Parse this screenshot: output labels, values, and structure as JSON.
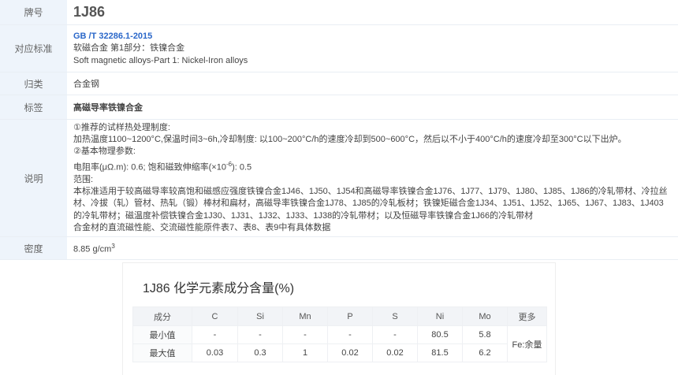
{
  "info": {
    "grade": {
      "label": "牌号",
      "value": "1J86"
    },
    "standard": {
      "label": "对应标准",
      "code": "GB /T 32286.1-2015",
      "title_cn": "软磁合金 第1部分：铁镍合金",
      "title_en": "Soft magnetic alloys-Part 1: Nickel-Iron alloys"
    },
    "classification": {
      "label": "归类",
      "value": "合金钢"
    },
    "tags": {
      "label": "标签",
      "value": "高磁导率铁镍合金"
    },
    "description": {
      "label": "说明",
      "lines": [
        "①推荐的试样热处理制度:",
        "加热温度1100~1200°C,保温时间3~6h,冷却制度: 以100~200°C/h的速度冷却到500~600°C，然后以不小于400°C/h的速度冷却至300°C以下出炉。",
        "②基本物理参数:"
      ],
      "physical_prefix": "电阻率(μΩ.m): 0.6;  饱和磁致伸缩率(×10",
      "physical_exp": "-6",
      "physical_suffix": "): 0.5",
      "scope_label": "范围:",
      "scope_text": "本标准适用于较高磁导率较高饱和磁感应强度铁镍合金1J46、1J50、1J54和高磁导率铁镍合金1J76、1J77、1J79、1J80、1J85、1J86的冷轧带材、冷拉丝材、冷拔（轧）管材、热轧（锻）棒材和扁材，高磁导率铁镍合金1J78、1J85的冷轧板材；铁镍矩磁合金1J34、1J51、1J52、1J65、1J67、1J83、1J403的冷轧带材；磁温度补偿铁镍合金1J30、1J31、1J32、1J33、1J38的冷轧带材；以及恒磁导率铁镍合金1J66的冷轧带材",
      "note": "合金材的直流磁性能、交流磁性能原件表7、表8、表9中有具体数据"
    },
    "density": {
      "label": "密度",
      "value": "8.85 g/cm",
      "unit_sup": "3"
    }
  },
  "composition": {
    "title": "1J86 化学元素成分含量(%)",
    "header": [
      "成分",
      "C",
      "Si",
      "Mn",
      "P",
      "S",
      "Ni",
      "Mo",
      "更多"
    ],
    "rows": [
      {
        "label": "最小值",
        "values": [
          "-",
          "-",
          "-",
          "-",
          "-",
          "80.5",
          "5.8"
        ]
      },
      {
        "label": "最大值",
        "values": [
          "0.03",
          "0.3",
          "1",
          "0.02",
          "0.02",
          "81.5",
          "6.2"
        ]
      }
    ],
    "more": "Fe:余量"
  }
}
